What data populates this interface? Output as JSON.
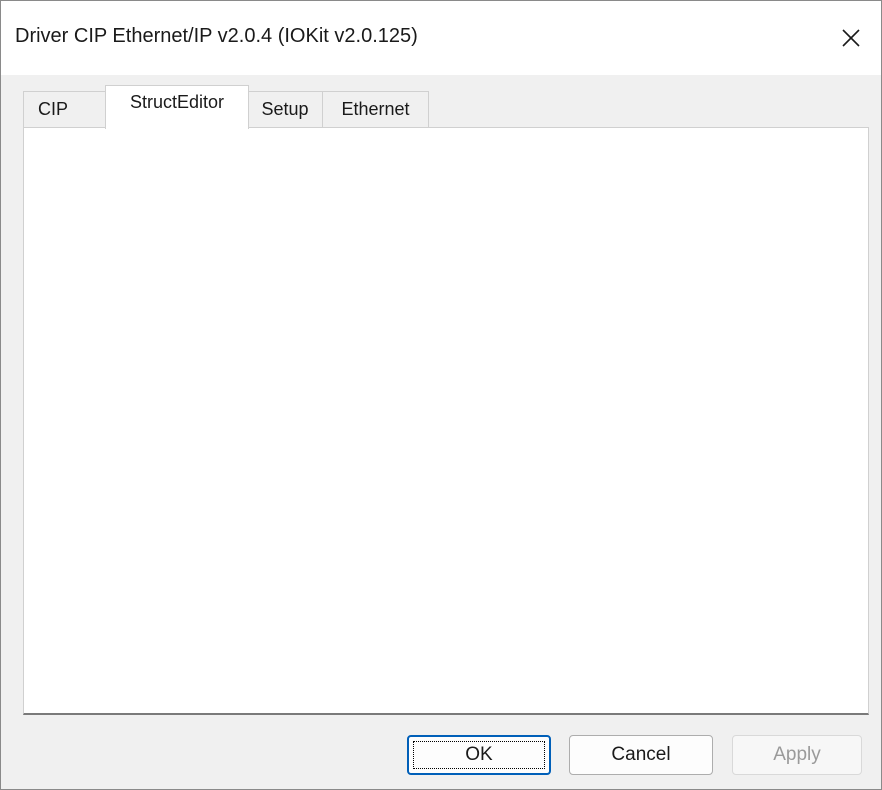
{
  "window": {
    "title": "Driver CIP Ethernet/IP v2.0.4 (IOKit v2.0.125)",
    "close_icon": "close-icon"
  },
  "tabs": [
    {
      "label": "CIP",
      "active": false
    },
    {
      "label": "StructEditor",
      "active": true
    },
    {
      "label": "Setup",
      "active": false
    },
    {
      "label": "Ethernet",
      "active": false
    }
  ],
  "buttons": {
    "ok": "OK",
    "cancel": "Cancel",
    "apply": "Apply",
    "apply_enabled": false
  },
  "colors": {
    "focus_blue": "#005fb8",
    "disabled_text": "#9a9a9a"
  }
}
